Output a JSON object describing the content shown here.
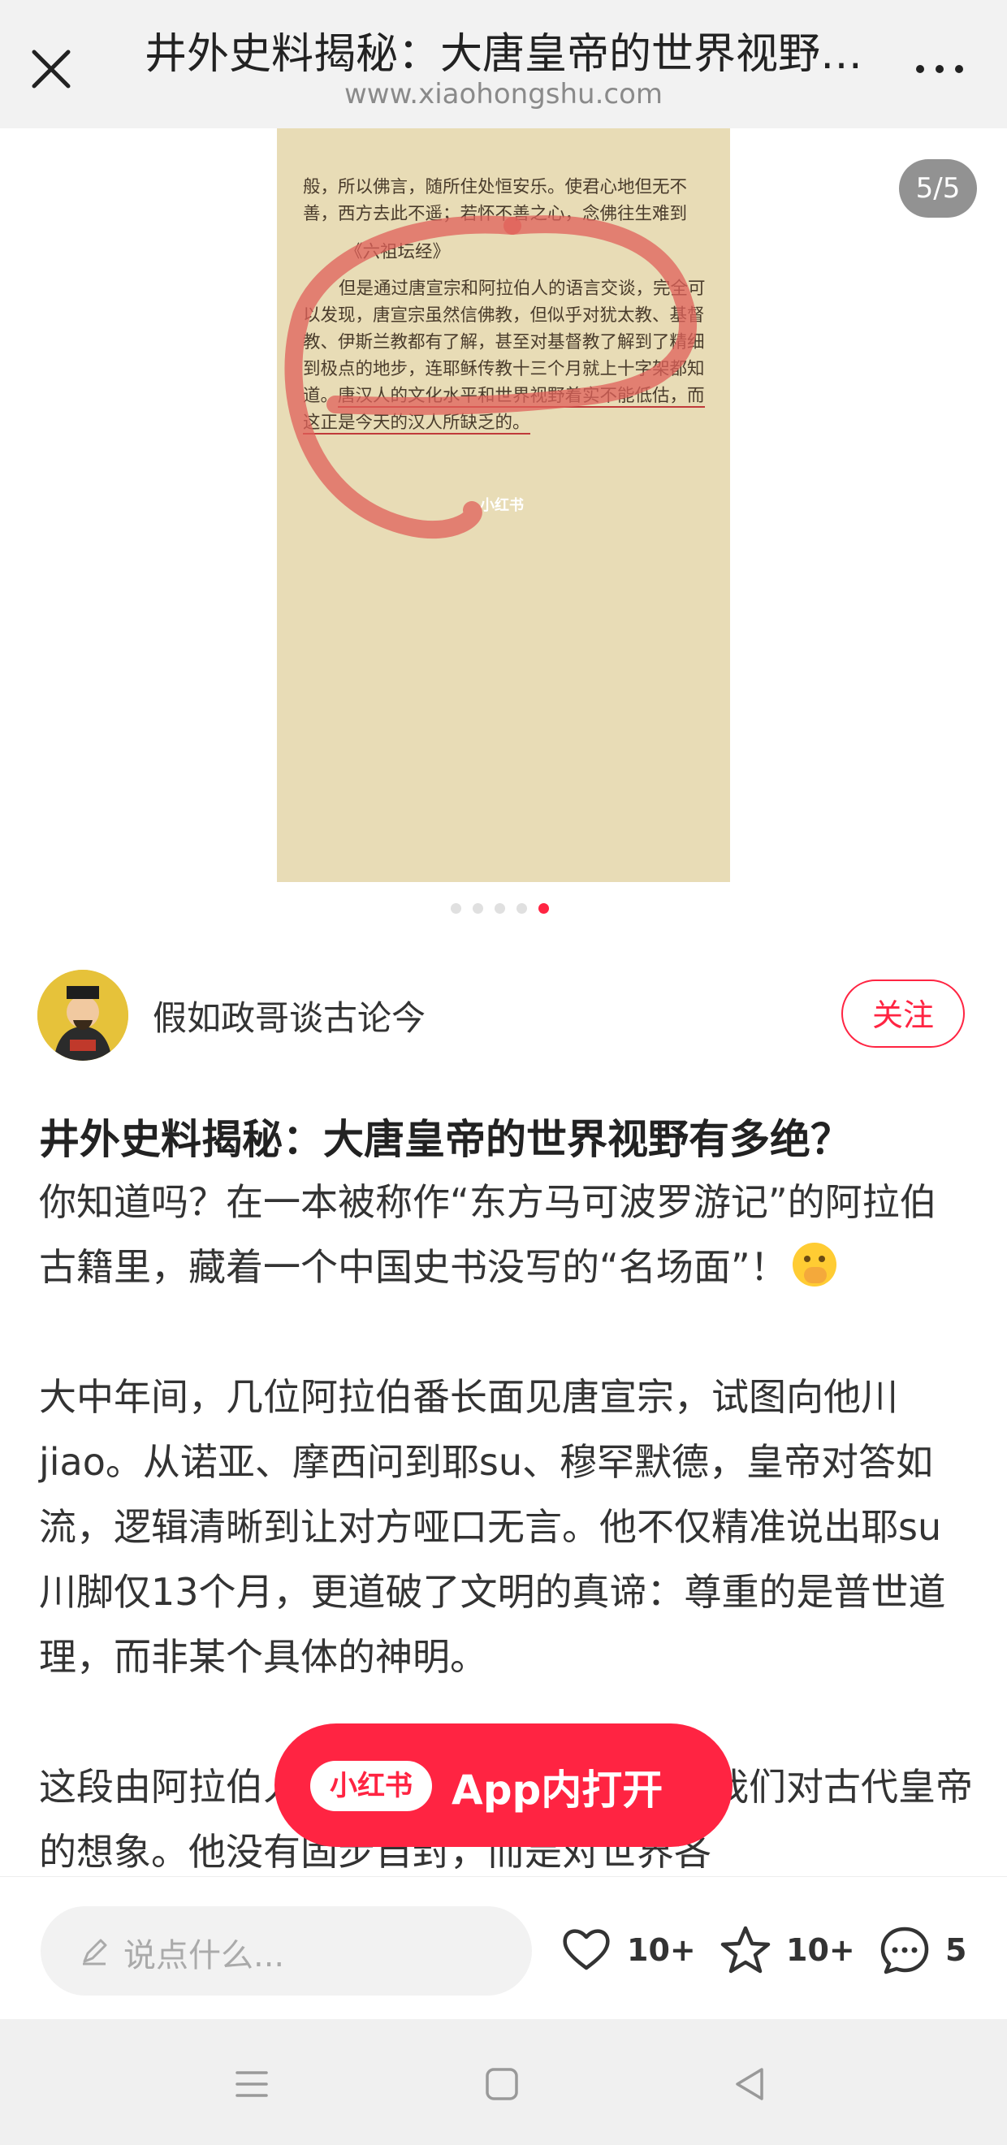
{
  "header": {
    "title": "井外史料揭秘：大唐皇帝的世界视野…",
    "url": "www.xiaohongshu.com",
    "close_icon": "close-icon",
    "more_icon": "more-icon"
  },
  "image_viewer": {
    "page_indicator": "5/5",
    "page_count": 5,
    "current_page": 5,
    "book_page": {
      "lines": [
        "般，所以佛言，随所住处恒安乐。使君心地但无不",
        "善，西方去此不遥；若怀不善之心，念佛往生难到"
      ],
      "citation": "《六祖坛经》",
      "paragraph_lead": "但是通过唐宣宗和阿拉伯人的语言交谈，完全可以发现，唐宣宗虽然信佛教，但似乎对犹太教、基督教、伊斯兰教都有了解，甚至对基督教了解到了精细到极点的地步，连耶稣传教十三个月就上十字架都知道。",
      "paragraph_underlined": "唐汉人的文化水平和世界视野着实不能低估，而这正是今天的汉人所缺乏的。",
      "watermark": "小红书"
    }
  },
  "author": {
    "name": "假如政哥谈古论今",
    "follow_label": "关注"
  },
  "post": {
    "title": "井外史料揭秘：大唐皇帝的世界视野有多绝？",
    "p1": "你知道吗？在一本被称作“东方马可波罗游记”的阿拉伯古籍里，藏着一个中国史书没写的“名场面”！",
    "p2": "大中年间，几位阿拉伯番长面见唐宣宗，试图向他川jiao。从诺亚、摩西问到耶su、穆罕默德，皇帝对答如流，逻辑清晰到让对方哑口无言。他不仅精准说出耶su川脚仅13个月，更道破了文明的真谛：尊重的是普世道理，而非某个具体的神明。",
    "p3": "这段由阿拉伯人记录的史料，彻底颠覆了我们对古代皇帝的想象。他没有固步自封，而是对世界各"
  },
  "open_app": {
    "logo": "小红书",
    "label": "App内打开"
  },
  "actions": {
    "comment_placeholder": "说点什么...",
    "likes": "10+",
    "favorites": "10+",
    "comments": "5"
  },
  "colors": {
    "brand": "#ff2442",
    "book_paper": "#e8dcb6",
    "marker_red": "#e0605a"
  }
}
